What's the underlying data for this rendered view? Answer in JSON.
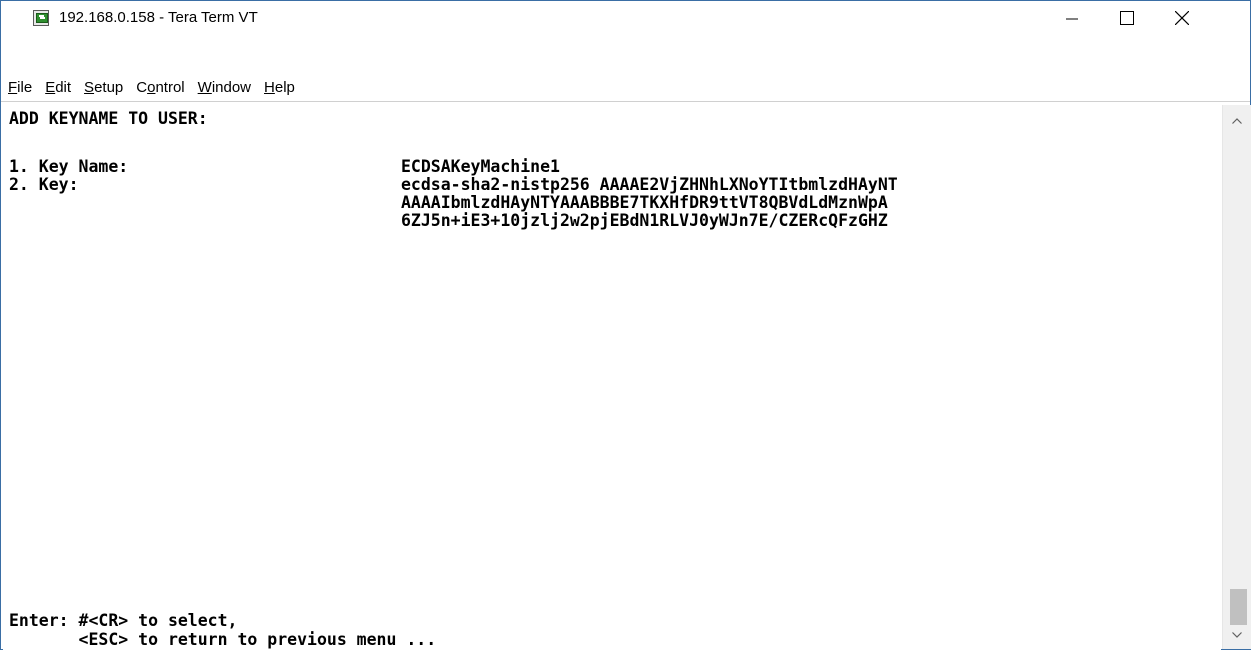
{
  "window": {
    "title": "192.168.0.158 - Tera Term VT",
    "app_icon": "teraterm-icon"
  },
  "menu": [
    {
      "accel": "F",
      "rest": "ile"
    },
    {
      "accel": "E",
      "rest": "dit"
    },
    {
      "accel": "S",
      "rest": "etup"
    },
    {
      "pre": "C",
      "accel": "o",
      "rest": "ntrol"
    },
    {
      "accel": "W",
      "rest": "indow"
    },
    {
      "accel": "H",
      "rest": "elp"
    }
  ],
  "terminal": {
    "heading": "ADD KEYNAME TO USER:",
    "item1_label": "1. Key Name:",
    "item1_value": "ECDSAKeyMachine1",
    "item2_label": "2. Key:",
    "key_line1": "ecdsa-sha2-nistp256 AAAAE2VjZHNhLXNoYTItbmlzdHAyNT",
    "key_line2": "AAAAIbmlzdHAyNTYAAABBBE7TKXHfDR9ttVT8QBVdLdMznWpA",
    "key_line3": "6ZJ5n+iE3+10jzlj2w2pjEBdN1RLVJ0yWJn7E/CZERcQFzGHZ",
    "prompt_line1": "Enter: #<CR> to select,",
    "prompt_line2": "       <ESC> to return to previous menu ..."
  }
}
